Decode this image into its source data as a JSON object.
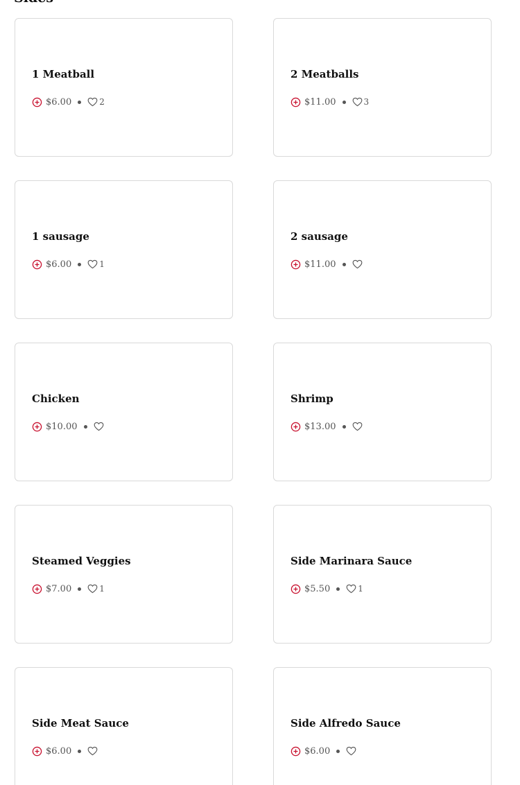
{
  "section": {
    "title": "Sides"
  },
  "colors": {
    "accent": "#c8102e",
    "border": "#d9d9d9",
    "text": "#111111",
    "muted": "#555555"
  },
  "icons": {
    "add": "plus-circle-icon",
    "like": "heart-outline-icon"
  },
  "items": [
    {
      "name": "1 Meatball",
      "price": "$6.00",
      "likes": "2"
    },
    {
      "name": "2 Meatballs",
      "price": "$11.00",
      "likes": "3"
    },
    {
      "name": "1 sausage",
      "price": "$6.00",
      "likes": "1"
    },
    {
      "name": "2 sausage",
      "price": "$11.00",
      "likes": ""
    },
    {
      "name": "Chicken",
      "price": "$10.00",
      "likes": ""
    },
    {
      "name": "Shrimp",
      "price": "$13.00",
      "likes": ""
    },
    {
      "name": "Steamed Veggies",
      "price": "$7.00",
      "likes": "1"
    },
    {
      "name": "Side Marinara Sauce",
      "price": "$5.50",
      "likes": "1"
    },
    {
      "name": "Side Meat Sauce",
      "price": "$6.00",
      "likes": ""
    },
    {
      "name": "Side Alfredo Sauce",
      "price": "$6.00",
      "likes": ""
    }
  ]
}
